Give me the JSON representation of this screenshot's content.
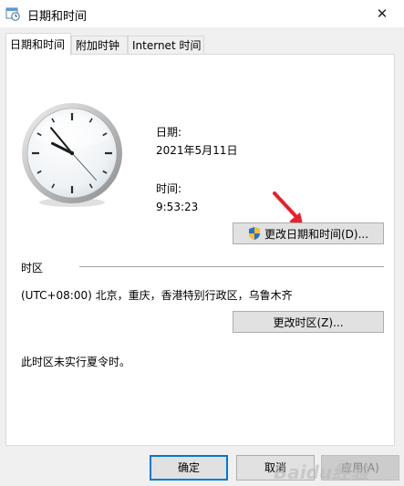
{
  "window": {
    "title": "日期和时间",
    "close_glyph": "✕"
  },
  "tabs": [
    {
      "label": "日期和时间",
      "active": true
    },
    {
      "label": "附加时钟",
      "active": false
    },
    {
      "label": "Internet 时间",
      "active": false
    }
  ],
  "datetime": {
    "date_label": "日期:",
    "date_value": "2021年5月11日",
    "time_label": "时间:",
    "time_value": "9:53:23",
    "change_button": "更改日期和时间(D)..."
  },
  "timezone": {
    "section_label": "时区",
    "value": "(UTC+08:00) 北京，重庆，香港特别行政区，乌鲁木齐",
    "change_button": "更改时区(Z)...",
    "dst_note": "此时区未实行夏令时。"
  },
  "clock": {
    "hour": 9,
    "minute": 53,
    "second": 23
  },
  "footer": {
    "ok": "确定",
    "cancel": "取消",
    "apply": "应用(A)"
  },
  "icons": {
    "title_icon": "calendar-clock-icon",
    "shield": "uac-shield-icon",
    "annotation": "red-arrow-icon"
  },
  "colors": {
    "accent": "#0078d7",
    "arrow": "#e8202a",
    "button_face": "#e1e1e1"
  },
  "watermark": "Baidu经验"
}
